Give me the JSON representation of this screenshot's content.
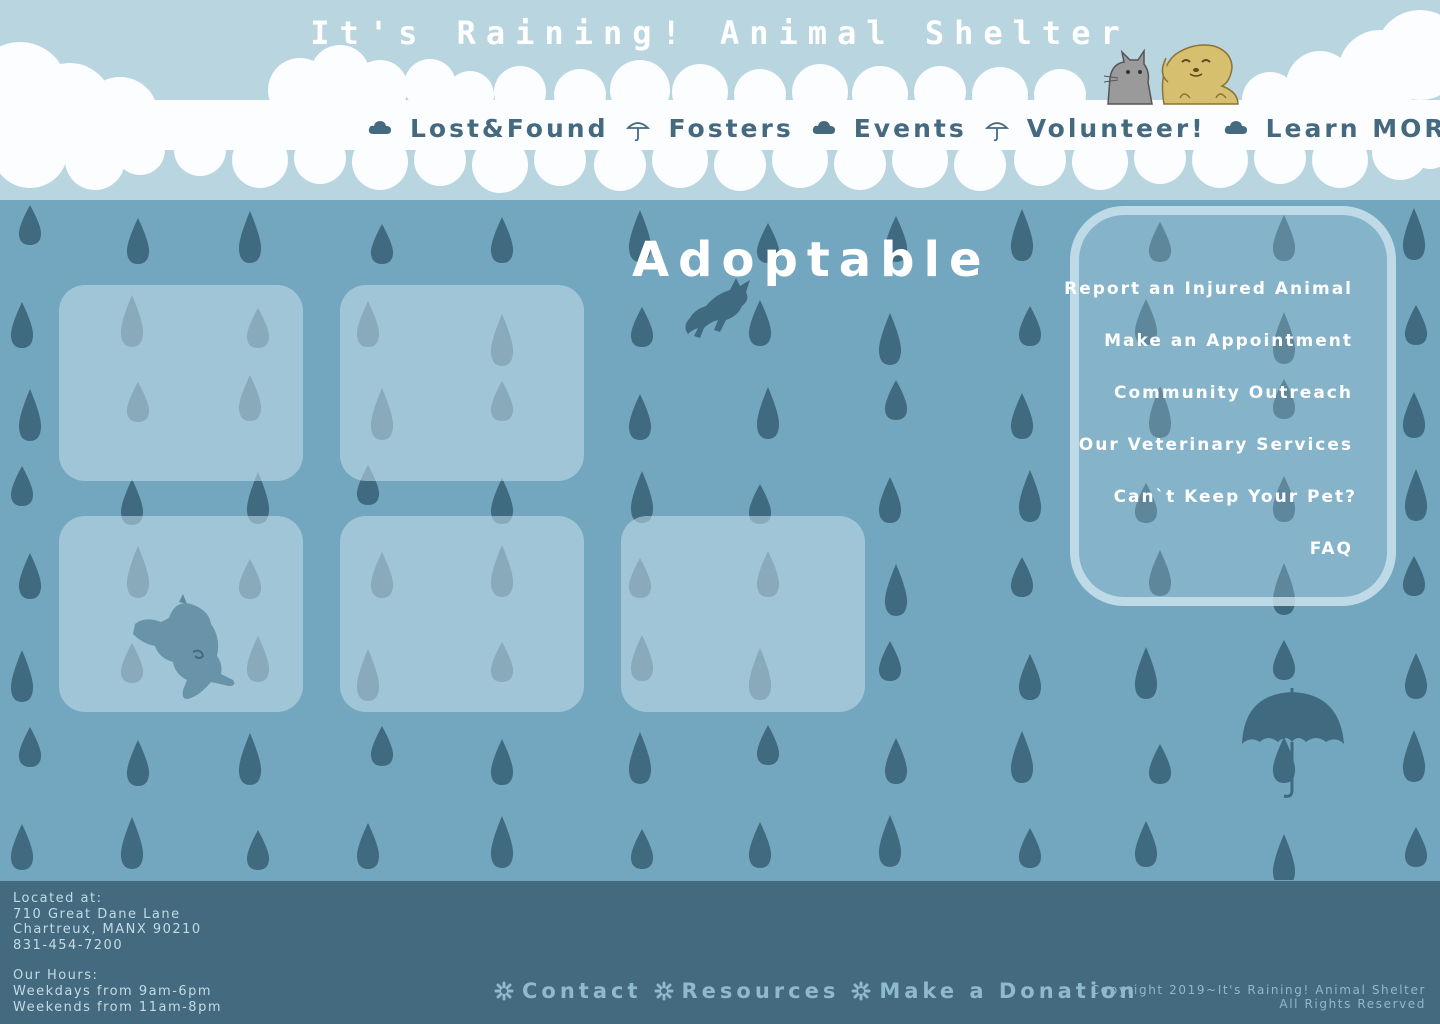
{
  "header": {
    "site_title": "It's Raining! Animal Shelter",
    "nav": [
      {
        "label": "Lost&Found",
        "icon": "cloud-icon"
      },
      {
        "label": "Fosters",
        "icon": "umbrella-icon"
      },
      {
        "label": "Events",
        "icon": "cloud-icon"
      },
      {
        "label": "Volunteer!",
        "icon": "umbrella-icon"
      },
      {
        "label": "Learn MORE",
        "icon": "cloud-icon"
      }
    ],
    "mascots": [
      "cat-mascot-icon",
      "dog-mascot-icon"
    ]
  },
  "main": {
    "heading": "Adoptable",
    "cards_count_visible": 5
  },
  "sidebar": {
    "links": [
      "Report an Injured Animal",
      "Make an Appointment",
      "Community Outreach",
      "Our Veterinary Services",
      "Can`t Keep Your Pet?",
      "FAQ"
    ]
  },
  "footer": {
    "address": {
      "label": "Located at:",
      "street": "710 Great Dane Lane",
      "city": "Chartreux, MANX 90210",
      "phone": "831-454-7200"
    },
    "hours": {
      "label": "Our Hours:",
      "weekdays": "Weekdays from 9am-6pm",
      "weekends": "Weekends from 11am-8pm"
    },
    "links": [
      "Contact",
      "Resources",
      "Make a Donation"
    ],
    "copyright_line1": "Copyright 2019~It's Raining! Animal Shelter",
    "copyright_line2": "All Rights Reserved"
  },
  "colors": {
    "sky": "#b8d5e0",
    "rain_bg": "#73a7bf",
    "raindrop": "#3f6a80",
    "nav_text": "#45697f",
    "footer_bg": "#436a7e",
    "footer_text": "#8fb9cc",
    "card": "#c4dee9"
  }
}
